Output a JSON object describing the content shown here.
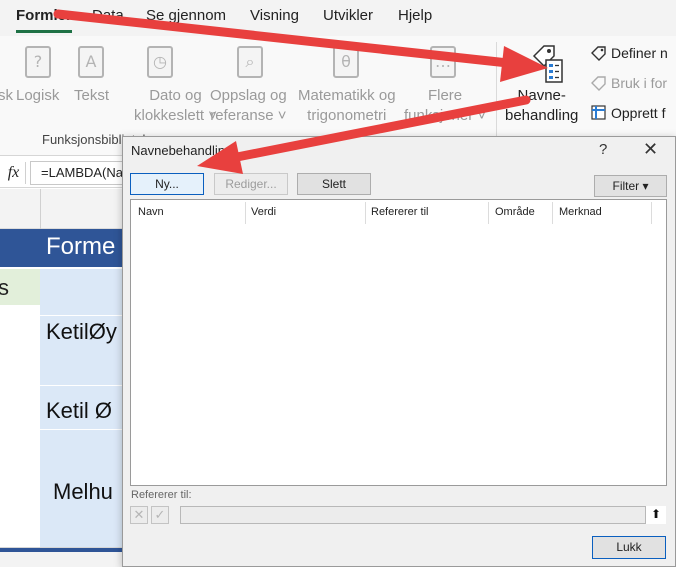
{
  "ribbon_tabs": [
    "Formler",
    "Data",
    "Se gjennom",
    "Visning",
    "Utvikler",
    "Hjelp"
  ],
  "ribbon": {
    "left_cut_label": "sk",
    "items": [
      {
        "label1": "Logisk",
        "label2": "",
        "icon": "question-book-icon",
        "glyph": "?"
      },
      {
        "label1": "Tekst",
        "label2": "",
        "icon": "text-book-icon",
        "glyph": "A"
      },
      {
        "label1": "Dato og",
        "label2": "klokkeslett ˅",
        "icon": "clock-book-icon",
        "glyph": "◷"
      },
      {
        "label1": "Oppslag og",
        "label2": "referanse ˅",
        "icon": "search-book-icon",
        "glyph": "⌕"
      },
      {
        "label1": "Matematikk og",
        "label2": "trigonometri",
        "icon": "theta-book-icon",
        "glyph": "θ"
      },
      {
        "label1": "Flere",
        "label2": "funksjoner ˅",
        "icon": "more-functions-book-icon",
        "glyph": "…"
      }
    ],
    "group_label": "Funksjonsbibliotek",
    "name_manager": {
      "label1": "Navne-",
      "label2": "behandling"
    },
    "define_name": "Definer n",
    "use_in_formula": "Bruk i for",
    "create_from_selection": "Opprett f"
  },
  "formula_bar": {
    "fx": "fx",
    "text": "=LAMBDA(Na"
  },
  "sheet": {
    "header_text": "Forme",
    "left_green_text": "s",
    "cells": [
      "KetilØy",
      "Ketil Ø",
      "Melhu"
    ]
  },
  "dialog": {
    "title": "Navnebehandling",
    "help": "?",
    "close": "✕",
    "buttons": {
      "new": "Ny...",
      "edit": "Rediger...",
      "delete": "Slett",
      "filter": "Filter ▾"
    },
    "columns": [
      "Navn",
      "Verdi",
      "Refererer til",
      "Område",
      "Merknad"
    ],
    "refers_to_label": "Refererer til:",
    "close_button": "Lukk"
  },
  "colors": {
    "arrow_red": "#e8403e",
    "sheet_blue_header": "#2f5597",
    "sheet_light_blue": "#dbe8f7",
    "sheet_light_green": "#e2efda"
  }
}
